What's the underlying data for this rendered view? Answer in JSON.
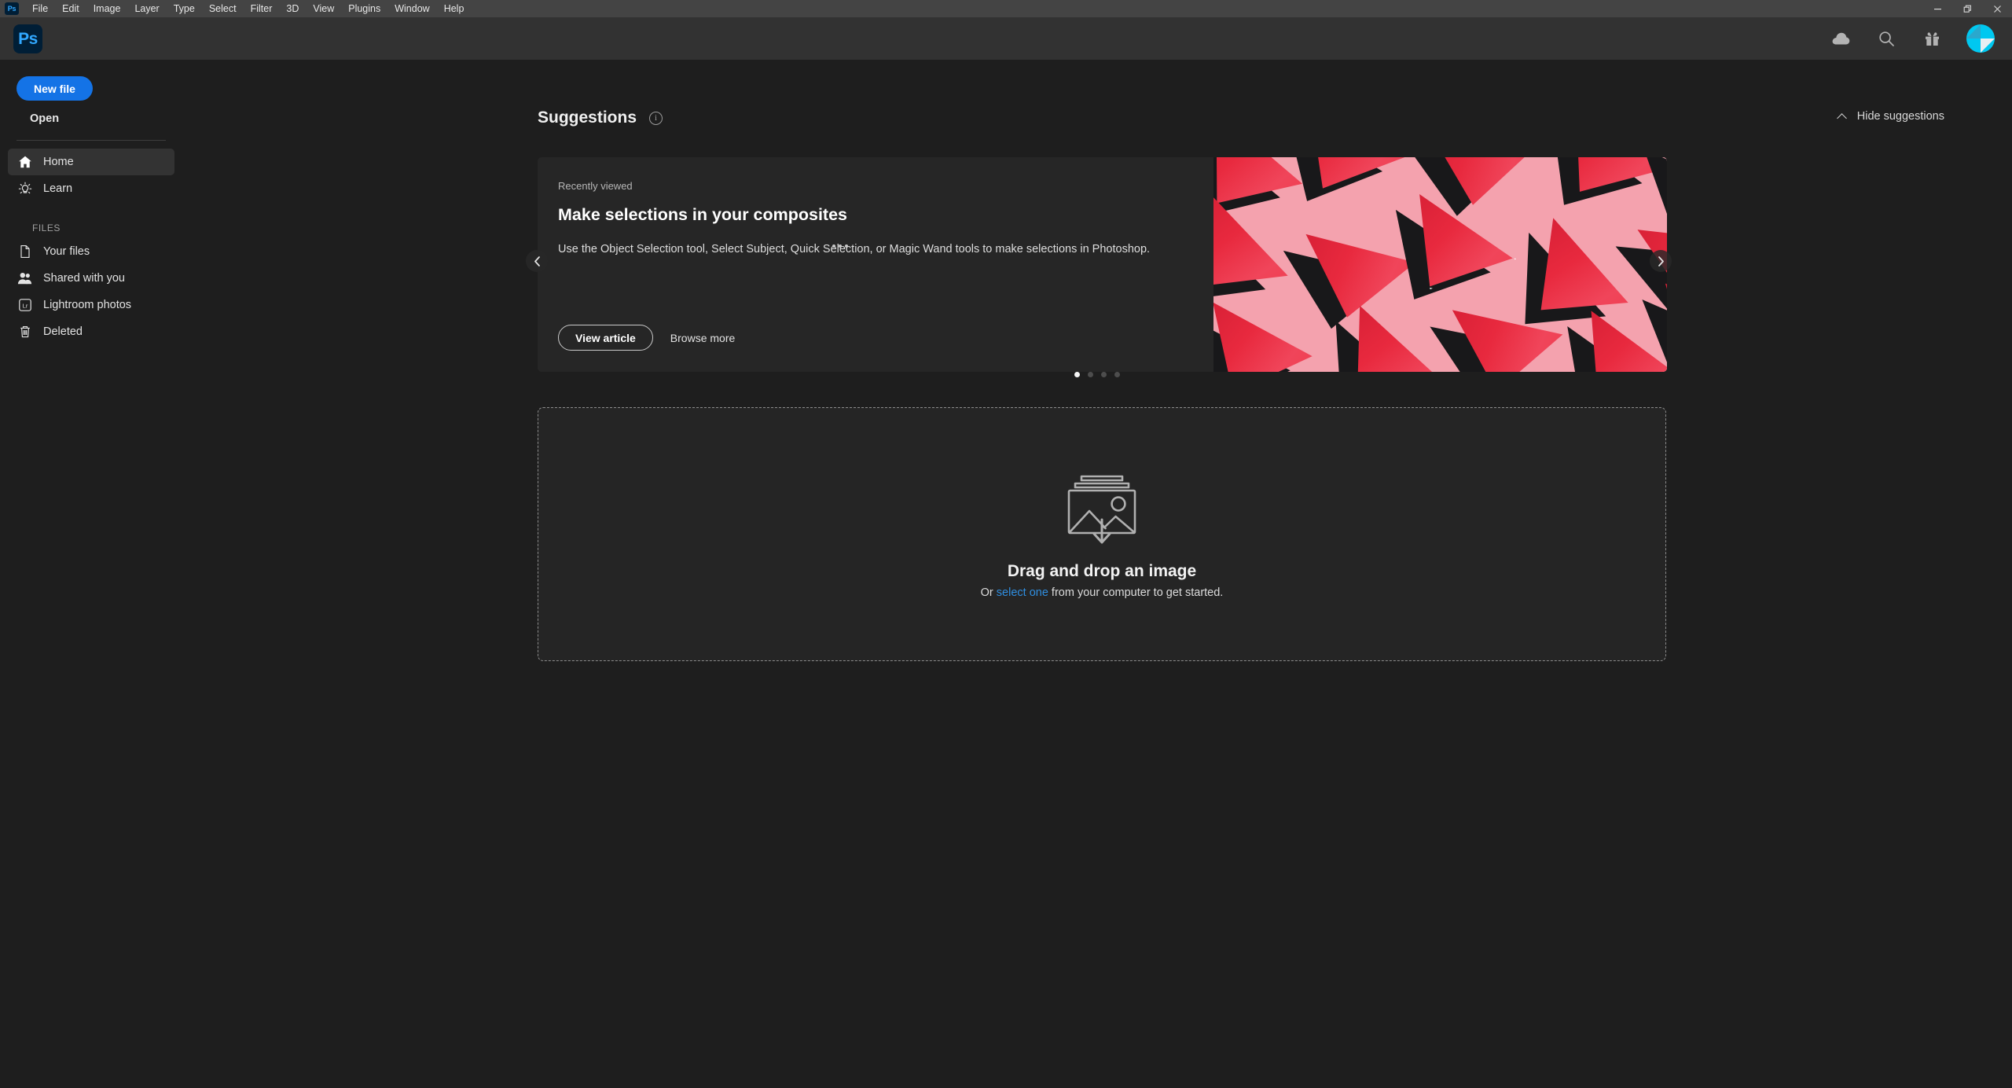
{
  "window": {
    "app_badge": "Ps",
    "menus": [
      "File",
      "Edit",
      "Image",
      "Layer",
      "Type",
      "Select",
      "Filter",
      "3D",
      "View",
      "Plugins",
      "Window",
      "Help"
    ],
    "controls": {
      "minimize": "minimize-icon",
      "restore": "restore-icon",
      "close": "close-icon"
    }
  },
  "appbar": {
    "logo_text": "Ps",
    "icons": [
      "cloud-icon",
      "search-icon",
      "gift-icon",
      "avatar"
    ],
    "colors": {
      "logo_bg": "#001e36",
      "logo_fg": "#31a8ff",
      "bar_bg": "#323232",
      "avatar": "#00c8f0"
    }
  },
  "sidebar": {
    "new_file_label": "New file",
    "open_label": "Open",
    "nav": [
      {
        "label": "Home",
        "icon": "home-icon",
        "active": true
      },
      {
        "label": "Learn",
        "icon": "lightbulb-icon",
        "active": false
      }
    ],
    "files_section_label": "FILES",
    "files": [
      {
        "label": "Your files",
        "icon": "document-icon"
      },
      {
        "label": "Shared with you",
        "icon": "people-icon"
      },
      {
        "label": "Lightroom photos",
        "icon": "lightroom-icon"
      },
      {
        "label": "Deleted",
        "icon": "trash-icon"
      }
    ],
    "accent": "#1473e6"
  },
  "suggestions": {
    "title": "Suggestions",
    "info_icon": "info-icon",
    "hide_label": "Hide suggestions",
    "hide_icon": "chevron-up-icon",
    "card": {
      "kicker": "Recently viewed",
      "title": "Make selections in your composites",
      "description": "Use the Object Selection tool, Select Subject, Quick Selection, or Magic Wand tools to make selections in Photoshop.",
      "primary_button": "View article",
      "secondary_button": "Browse more",
      "more_icon": "more-options-icon",
      "image_alt": "watermelon-slices-pattern",
      "image_colors": {
        "background": "#f4a2ae",
        "flesh": "#e8293e",
        "rind": "#cfe08a",
        "shadow": "#18181a"
      }
    },
    "carousel": {
      "prev_icon": "chevron-left-icon",
      "next_icon": "chevron-right-icon",
      "dot_count": 4,
      "active_dot": 0
    }
  },
  "dropzone": {
    "icon": "image-download-icon",
    "title": "Drag and drop an image",
    "sub_prefix": "Or ",
    "link": "select one",
    "sub_suffix": " from your computer to get started.",
    "link_color": "#2f8ee0"
  }
}
